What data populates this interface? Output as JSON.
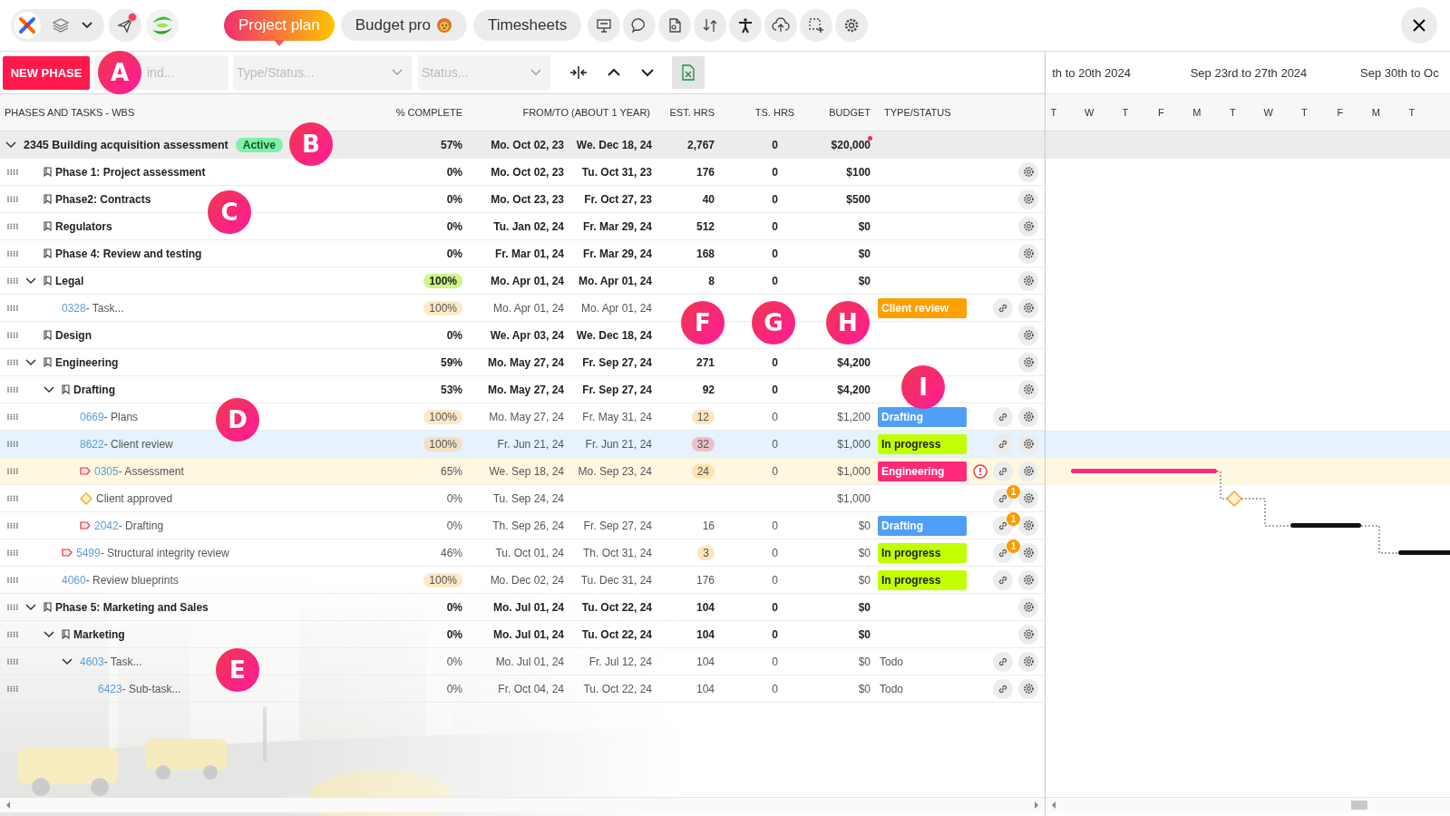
{
  "top_bar": {
    "notification": true,
    "tabs": [
      {
        "label": "Project plan",
        "selected": true
      },
      {
        "label": "Budget pro",
        "selected": false
      },
      {
        "label": "Timesheets",
        "selected": false
      }
    ]
  },
  "toolbar": {
    "new_button": "NEW PHASE",
    "search": {
      "placeholder": "ind..."
    },
    "type_filter": {
      "placeholder": "Type/Status..."
    },
    "status_filter": {
      "placeholder": "Status..."
    }
  },
  "table": {
    "columns": [
      "PHASES AND TASKS - WBS",
      "% COMPLETE",
      "FROM/TO (ABOUT 1 YEAR)",
      "EST. HRS",
      "TS. HRS",
      "BUDGET",
      "TYPE/STATUS"
    ],
    "rows": [
      {
        "kind": "project",
        "name": "2345 Building acquisition assessment",
        "badge": "Active",
        "pct": "57%",
        "from": "Mo. Oct 02, 23",
        "to": "We. Dec 18, 24",
        "est": "2,767",
        "ts": "0",
        "budget": "$20,000",
        "budget_alert": true,
        "expanded": true,
        "selected": false,
        "children": [
          {
            "kind": "phase",
            "name": "Phase 1: Project assessment",
            "pct": "0%",
            "from": "Mo. Oct 02, 23",
            "to": "Tu. Oct 31, 23",
            "est": "176",
            "ts": "0",
            "budget": "$100",
            "selected": false
          },
          {
            "kind": "phase",
            "name": "Phase2: Contracts",
            "pct": "0%",
            "from": "Mo. Oct 23, 23",
            "to": "Fr. Oct 27, 23",
            "est": "40",
            "ts": "0",
            "budget": "$500",
            "selected": false
          },
          {
            "kind": "phase",
            "name": "Regulators",
            "pct": "0%",
            "from": "Tu. Jan 02, 24",
            "to": "Fr. Mar 29, 24",
            "est": "512",
            "ts": "0",
            "budget": "$0",
            "selected": false
          },
          {
            "kind": "phase",
            "name": "Phase 4: Review and testing",
            "pct": "0%",
            "from": "Fr. Mar 01, 24",
            "to": "Fr. Mar 29, 24",
            "est": "168",
            "ts": "0",
            "budget": "$0",
            "selected": false
          },
          {
            "kind": "phase",
            "name": "Legal",
            "pct": "100%",
            "pct_badge": true,
            "from": "Mo. Apr 01, 24",
            "to": "Mo. Apr 01, 24",
            "est": "8",
            "ts": "0",
            "budget": "$0",
            "expanded": true,
            "selected": false,
            "children": [
              {
                "kind": "task",
                "id": "0328",
                "name": "- Task...",
                "pct": "100%",
                "pct_badge": true,
                "from": "Mo. Apr 01, 24",
                "to": "Mo. Apr 01, 24",
                "status": {
                  "label": "Client review",
                  "color": "#ff9f00"
                },
                "selected": false
              }
            ]
          },
          {
            "kind": "phase",
            "name": "Design",
            "pct": "0%",
            "from": "We. Apr 03, 24",
            "to": "We. Dec 18, 24",
            "selected": false
          },
          {
            "kind": "phase",
            "name": "Engineering",
            "pct": "59%",
            "from": "Mo. May 27, 24",
            "to": "Fr. Sep 27, 24",
            "est": "271",
            "ts": "0",
            "budget": "$4,200",
            "expanded": true,
            "selected": false,
            "children": [
              {
                "kind": "phase",
                "name": "Drafting",
                "pct": "53%",
                "from": "Mo. May 27, 24",
                "to": "Fr. Sep 27, 24",
                "est": "92",
                "ts": "0",
                "budget": "$4,200",
                "expanded": true,
                "selected": false,
                "children": [
                  {
                    "kind": "task",
                    "id": "0669",
                    "name": "- Plans",
                    "pct": "100%",
                    "pct_badge": true,
                    "from": "Mo. May 27, 24",
                    "to": "Fr. May 31, 24",
                    "est": "12",
                    "est_warning": true,
                    "ts": "0",
                    "budget": "$1,200",
                    "status": {
                      "label": "Drafting",
                      "color": "#4f9ef8"
                    },
                    "selected": false
                  },
                  {
                    "kind": "task",
                    "id": "8622",
                    "name": "- Client review",
                    "pct": "100%",
                    "pct_badge": true,
                    "from": "Fr. Jun 21, 24",
                    "to": "Fr. Jun 21, 24",
                    "est": "32",
                    "est_over": true,
                    "ts": "0",
                    "budget": "$1,000",
                    "status": {
                      "label": "In progress",
                      "color": "#c2ff00"
                    },
                    "selected": true
                  },
                  {
                    "kind": "task",
                    "id": "0305",
                    "name": "- Assessment",
                    "flagged": true,
                    "warning": true,
                    "pct": "65%",
                    "from": "We. Sep 18, 24",
                    "to": "Mo. Sep 23, 24",
                    "est": "24",
                    "est_warning": true,
                    "ts": "0",
                    "budget": "$1,000",
                    "status": {
                      "label": "Engineering",
                      "color": "#ff2a7a"
                    },
                    "selected": false
                  },
                  {
                    "kind": "milestone",
                    "name": "Client approved",
                    "pct": "0%",
                    "from": "Tu. Sep 24, 24",
                    "budget": "$1,000",
                    "link_count": "1",
                    "selected": false
                  },
                  {
                    "kind": "task",
                    "id": "2042",
                    "name": "- Drafting",
                    "flagged": true,
                    "pct": "0%",
                    "from": "Th. Sep 26, 24",
                    "to": "Fr. Sep 27, 24",
                    "est": "16",
                    "ts": "0",
                    "budget": "$0",
                    "status": {
                      "label": "Drafting",
                      "color": "#4f9ef8"
                    },
                    "link_count": "1",
                    "selected": false
                  }
                ]
              },
              {
                "kind": "task",
                "id": "5499",
                "name": "- Structural integrity review",
                "flagged": true,
                "pct": "46%",
                "from": "Tu. Oct 01, 24",
                "to": "Th. Oct 31, 24",
                "est": "3",
                "est_warning": true,
                "ts": "0",
                "budget": "$0",
                "status": {
                  "label": "In progress",
                  "color": "#c2ff00"
                },
                "link_count": "1",
                "selected": false
              },
              {
                "kind": "task",
                "id": "4060",
                "name": "- Review blueprints",
                "pct": "100%",
                "pct_badge": true,
                "from": "Mo. Dec 02, 24",
                "to": "Tu. Dec 31, 24",
                "est": "176",
                "ts": "0",
                "budget": "$0",
                "status": {
                  "label": "In progress",
                  "color": "#c2ff00"
                },
                "selected": false
              }
            ]
          },
          {
            "kind": "phase",
            "name": "Phase 5: Marketing and Sales",
            "pct": "0%",
            "from": "Mo. Jul 01, 24",
            "to": "Tu. Oct 22, 24",
            "est": "104",
            "ts": "0",
            "budget": "$0",
            "expanded": true,
            "selected": false,
            "children": [
              {
                "kind": "phase",
                "name": "Marketing",
                "pct": "0%",
                "from": "Mo. Jul 01, 24",
                "to": "Tu. Oct 22, 24",
                "est": "104",
                "ts": "0",
                "budget": "$0",
                "expanded": true,
                "selected": false,
                "children": [
                  {
                    "kind": "task",
                    "id": "4603",
                    "name": "- Task...",
                    "pct": "0%",
                    "from": "Mo. Jul 01, 24",
                    "to": "Fr. Jul 12, 24",
                    "est": "104",
                    "ts": "0",
                    "budget": "$0",
                    "status": {
                      "label": "Todo"
                    },
                    "expanded": true,
                    "selected": false,
                    "children": [
                      {
                        "kind": "task",
                        "id": "6423",
                        "name": "- Sub-task...",
                        "pct": "0%",
                        "from": "Fr. Oct 04, 24",
                        "to": "Tu. Oct 22, 24",
                        "est": "104",
                        "ts": "0",
                        "budget": "$0",
                        "status": {
                          "label": "Todo"
                        },
                        "selected": false
                      }
                    ]
                  }
                ]
              }
            ]
          }
        ]
      }
    ]
  },
  "gantt": {
    "weeks": [
      "th to 20th 2024",
      "Sep 23rd to 27th 2024",
      "Sep 30th to Oc"
    ],
    "days": [
      "T",
      "W",
      "T",
      "F",
      "M",
      "T",
      "W",
      "T",
      "F",
      "M",
      "T"
    ]
  },
  "callouts": [
    "A",
    "B",
    "C",
    "D",
    "E",
    "F",
    "G",
    "H",
    "I"
  ]
}
